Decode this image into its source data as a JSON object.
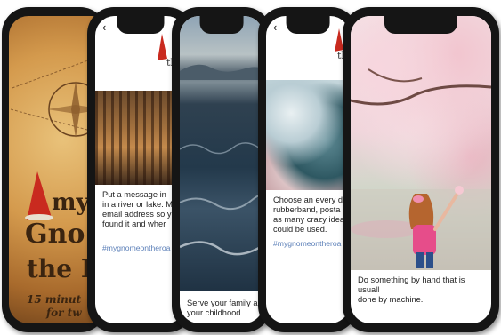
{
  "cover": {
    "title_line1": "my",
    "title_line2": "Gno",
    "title_line3": "the R",
    "subtitle_line1": "15 minut",
    "subtitle_line2": "for tw"
  },
  "screens": [
    {
      "caption": "Put a message in\nin a river or lake. M\nemail address so y\nfound it and wher",
      "hashtag": "#mygnomeontheroa"
    },
    {
      "caption": "Serve your family a\nyour childhood."
    },
    {
      "caption": "Choose an every d\nrubberband, posta\nas many crazy idea\ncould be used.",
      "hashtag": "#mygnomeontheroa"
    },
    {
      "caption": "Do something by hand that is usuall\ndone by machine."
    }
  ],
  "logo_text": "th",
  "back_symbol": "‹"
}
